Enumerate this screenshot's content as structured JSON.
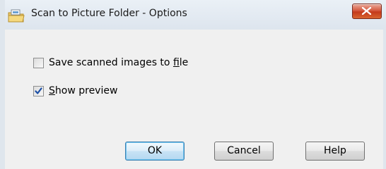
{
  "window": {
    "title": "Scan to Picture Folder - Options"
  },
  "options": {
    "save_to_file": {
      "prefix": "Save scanned images to ",
      "accel": "f",
      "suffix": "ile",
      "checked": false
    },
    "show_preview": {
      "prefix": "",
      "accel": "S",
      "suffix": "how preview",
      "checked": true
    }
  },
  "buttons": {
    "ok": "OK",
    "cancel": "Cancel",
    "help": "Help"
  },
  "icons": {
    "app": "folder-scanner-icon",
    "close": "close-icon",
    "check": "checkmark-icon"
  },
  "colors": {
    "close_red": "#c43a1c",
    "check_blue": "#1c4fa5",
    "default_button_border": "#3c7fb1"
  }
}
